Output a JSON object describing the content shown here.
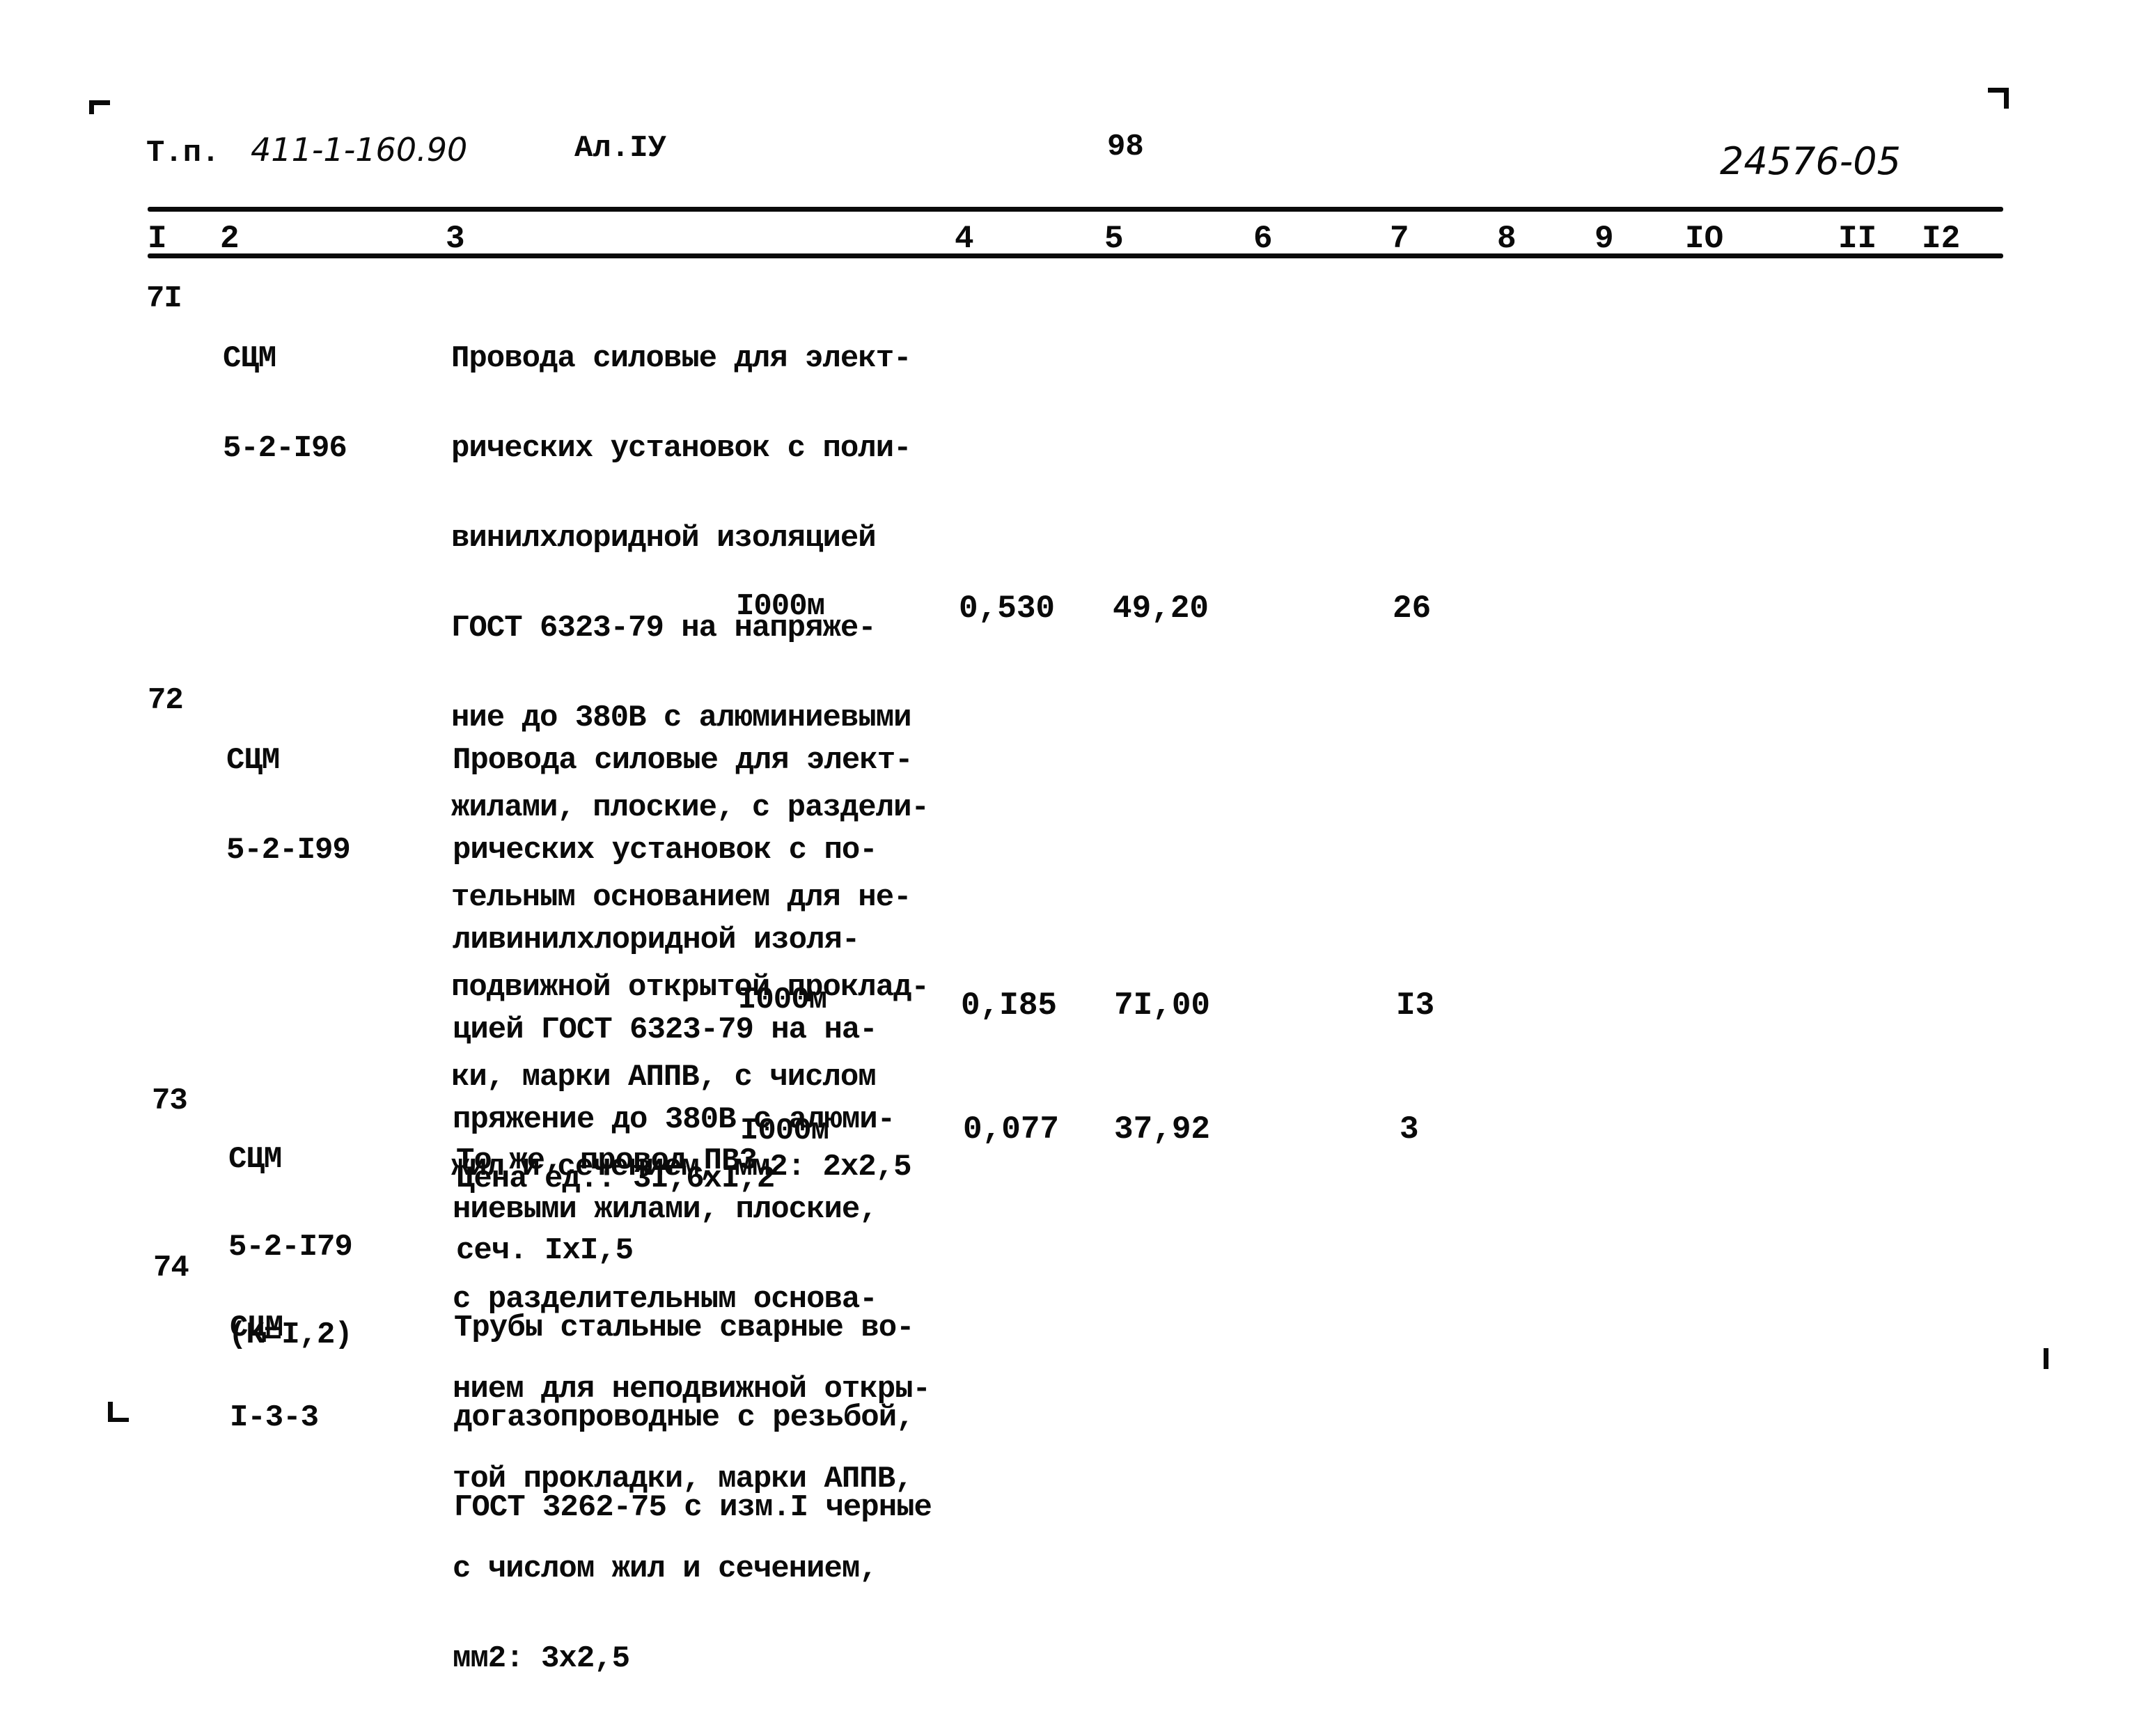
{
  "header": {
    "project_label": "Т.п.",
    "project_number": "411-1-160.90",
    "album": "Ал.IУ",
    "page_number": "98",
    "doc_code": "24576-05"
  },
  "columns": [
    "I",
    "2",
    "3",
    "4",
    "5",
    "6",
    "7",
    "8",
    "9",
    "IO",
    "II",
    "I2"
  ],
  "rows": [
    {
      "no": "7I",
      "code": [
        "СЦМ",
        "5-2-I96"
      ],
      "description": [
        "Провода силовые для элект-",
        "рических установок с поли-",
        "винилхлоридной изоляцией",
        "ГОСТ 6323-79 на напряже-",
        "ние до 380В с алюминиевыми",
        "жилами, плоские, с раздели-",
        "тельным основанием для не-",
        "подвижной открытой проклад-",
        "ки, марки АППВ, с числом",
        "жил и сечением, мм2: 2х2,5"
      ],
      "unit": "I000м",
      "col4": "0,530",
      "col5": "49,20",
      "col7": "26"
    },
    {
      "no": "72",
      "code": [
        "СЦМ",
        "5-2-I99"
      ],
      "description": [
        "Провода силовые для элект-",
        "рических установок с по-",
        "ливинилхлоридной изоля-",
        "цией ГОСТ 6323-79 на на-",
        "пряжение до 380В с алюми-",
        "ниевыми жилами, плоские,",
        "с разделительным основа-",
        "нием для неподвижной откры-",
        "той прокладки, марки АППВ,",
        "с числом жил и сечением,",
        "мм2: 3х2,5"
      ],
      "unit": "I000м",
      "col4": "0,I85",
      "col5": "7I,00",
      "col7": "I3"
    },
    {
      "no": "73",
      "code": [
        "СЦМ",
        "5-2-I79",
        "(К=I,2)"
      ],
      "description": [
        "То же, провод ПВ3",
        "сеч. IхI,5"
      ],
      "unit": "I000м",
      "price_note": "Цена ед.: 3I,6хI,2",
      "col4": "0,077",
      "col5": "37,92",
      "col7": "3"
    },
    {
      "no": "74",
      "code": [
        "СЦМ",
        "I-3-3"
      ],
      "description": [
        "Трубы стальные сварные во-",
        "догазопроводные с резьбой,",
        "ГОСТ 3262-75 с изм.I черные"
      ]
    }
  ]
}
